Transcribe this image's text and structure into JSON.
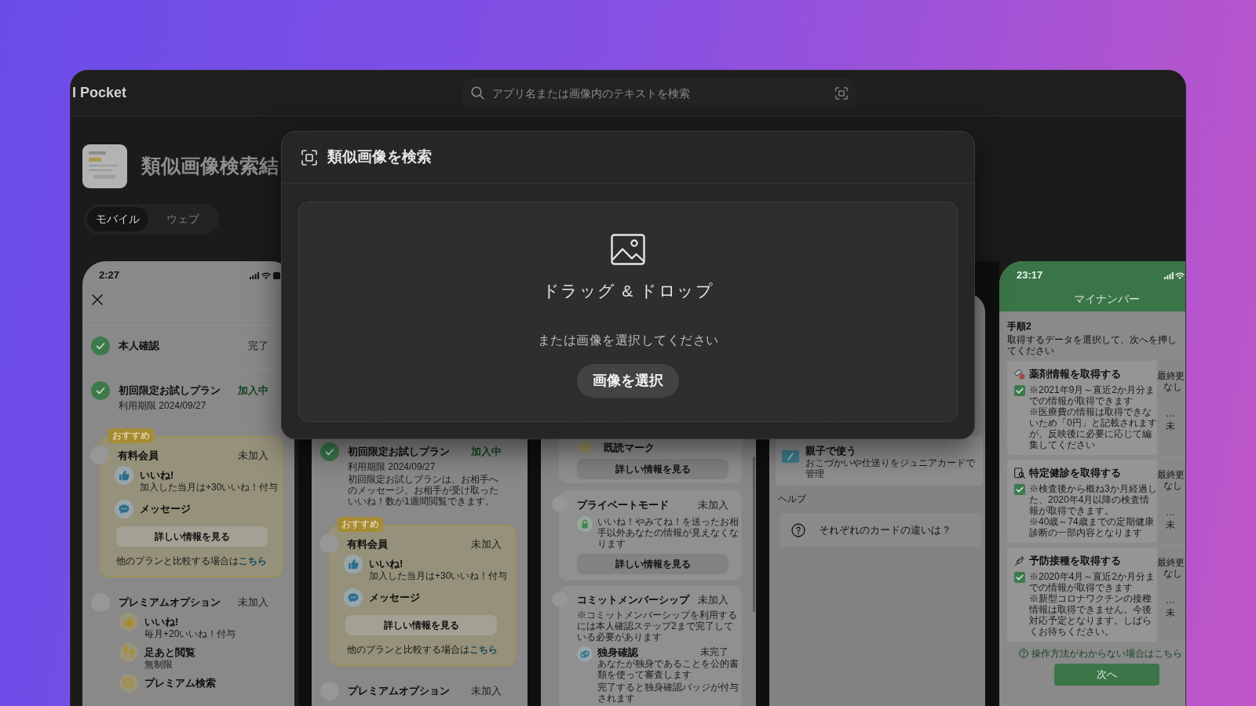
{
  "app": {
    "brand": "I Pocket"
  },
  "search": {
    "placeholder": "アプリ名または画像内のテキストを検索"
  },
  "page": {
    "title": "類似画像検索結",
    "tabs": [
      {
        "label": "モバイル",
        "selected": true
      },
      {
        "label": "ウェブ",
        "selected": false
      }
    ]
  },
  "screens": [
    {
      "kind": "membership",
      "status_bar": {
        "time": "2:27"
      },
      "steps": [
        {
          "title": "本人確認",
          "status": "完了",
          "status_active": false,
          "done": true
        },
        {
          "title": "初回限定お試しプラン",
          "note": "利用期限 2024/09/27",
          "status": "加入中",
          "status_active": true,
          "done": true
        }
      ],
      "featured": {
        "badge": "おすすめ",
        "title": "有料会員",
        "status": "未加入",
        "done": false,
        "features": [
          {
            "kind": "like",
            "title": "いいね!",
            "note": "加入した当月は+30いいね！付与"
          },
          {
            "kind": "message",
            "title": "メッセージ"
          }
        ],
        "button": "詳しい情報を見る",
        "compare": {
          "text": "他のプランと比較する場合は",
          "link": "こちら"
        }
      },
      "option": {
        "title": "プレミアムオプション",
        "status": "未加入",
        "done": false,
        "features": [
          {
            "kind": "like",
            "title": "いいね!",
            "note": "毎月+20いいね！付与"
          },
          {
            "kind": "footprints",
            "title": "足あと閲覧",
            "note": "無制限"
          },
          {
            "kind": "search",
            "title": "プレミアム検索"
          }
        ]
      }
    },
    {
      "kind": "membership_lower",
      "steps": [
        {
          "title": "初回限定お試しプラン",
          "note": "利用期限 2024/09/27",
          "description": "初回限定お試しプランは、お相手へのメッセージ、お相手が受け取ったいいね！数が1週間閲覧できます。",
          "status": "加入中",
          "status_active": true,
          "done": true
        }
      ],
      "featured": {
        "badge": "おすすめ",
        "title": "有料会員",
        "status": "未加入",
        "done": false,
        "features": [
          {
            "kind": "like",
            "title": "いいね!",
            "note": "加入した当月は+30いいね！付与"
          },
          {
            "kind": "message",
            "title": "メッセージ"
          }
        ],
        "button": "詳しい情報を見る",
        "compare": {
          "text": "他のプランと比較する場合は",
          "link": "こちら"
        }
      },
      "option": {
        "title": "プレミアムオプション",
        "status": "未加入",
        "done": false
      }
    },
    {
      "kind": "plans_lower",
      "top_feature": {
        "kind": "read",
        "title": "既読マーク"
      },
      "top_button": "詳しい情報を見る",
      "plans": [
        {
          "title": "プライベートモード",
          "status": "未加入",
          "done": false,
          "feature": {
            "kind": "lock",
            "text": "いいね！やみてね！を送ったお相手以外あなたの情報が見えなくなります"
          },
          "button": "詳しい情報を見る"
        },
        {
          "title": "コミットメンバーシップ",
          "status": "未加入",
          "done": false,
          "note": "※コミットメンバーシップを利用するには本人確認ステップ2まで完了している必要があります",
          "feature": {
            "kind": "rings",
            "title": "独身確認",
            "status": "未完了",
            "text": "あなたが独身であることを公的書類を使って審査します",
            "extra": "完了すると独身確認バッジが付与されます"
          }
        }
      ]
    },
    {
      "kind": "menu_lower",
      "items": [
        {
          "kind": "card",
          "title": "親子で使う",
          "note": "おこづかいや仕送りをジュニアカードで管理"
        }
      ],
      "section": "ヘルプ",
      "help_items": [
        {
          "kind": "question",
          "title": "それぞれのカードの違いは？"
        }
      ]
    },
    {
      "kind": "mynumber",
      "status_bar": {
        "time": "23:17"
      },
      "title": "マイナンバー",
      "step": "手順2",
      "instruction": "取得するデータを選択して、次へを押してください",
      "options": [
        {
          "kind": "medicine",
          "title": "薬剤情報を取得する",
          "checked": true,
          "notes": [
            "※2021年9月～直近2か月分までの情報が取得できます",
            "※医療費の情報は取得できないため「0円」と記載されますが、反映後に必要に応じて編集してください"
          ],
          "side": {
            "label": "最終更",
            "value": "なし",
            "more": "…",
            "state": "未"
          }
        },
        {
          "kind": "checkup",
          "title": "特定健診を取得する",
          "checked": true,
          "notes": [
            "※検査後から概ね3か月経過した、2020年4月以降の検査情報が取得できます。",
            "※40歳～74歳までの定期健康診断の一部内容となります"
          ],
          "side": {
            "label": "最終更",
            "value": "なし",
            "more": "…",
            "state": "未"
          }
        },
        {
          "kind": "vaccine",
          "title": "予防接種を取得する",
          "checked": true,
          "notes": [
            "※2020年4月～直近2か月分までの情報が取得できます",
            "※新型コロナワクチンの接種情報は取得できません。今後対応予定となります。しばらくお待ちください。"
          ],
          "side": {
            "label": "最終更",
            "value": "なし",
            "more": "…",
            "state": "未"
          }
        }
      ],
      "help": "操作方法がわからない場合はこちら",
      "next": "次へ"
    }
  ],
  "modal": {
    "title": "類似画像を検索",
    "drop_title": "ドラッグ & ドロップ",
    "drop_hint": "または画像を選択してください",
    "button": "画像を選択"
  }
}
